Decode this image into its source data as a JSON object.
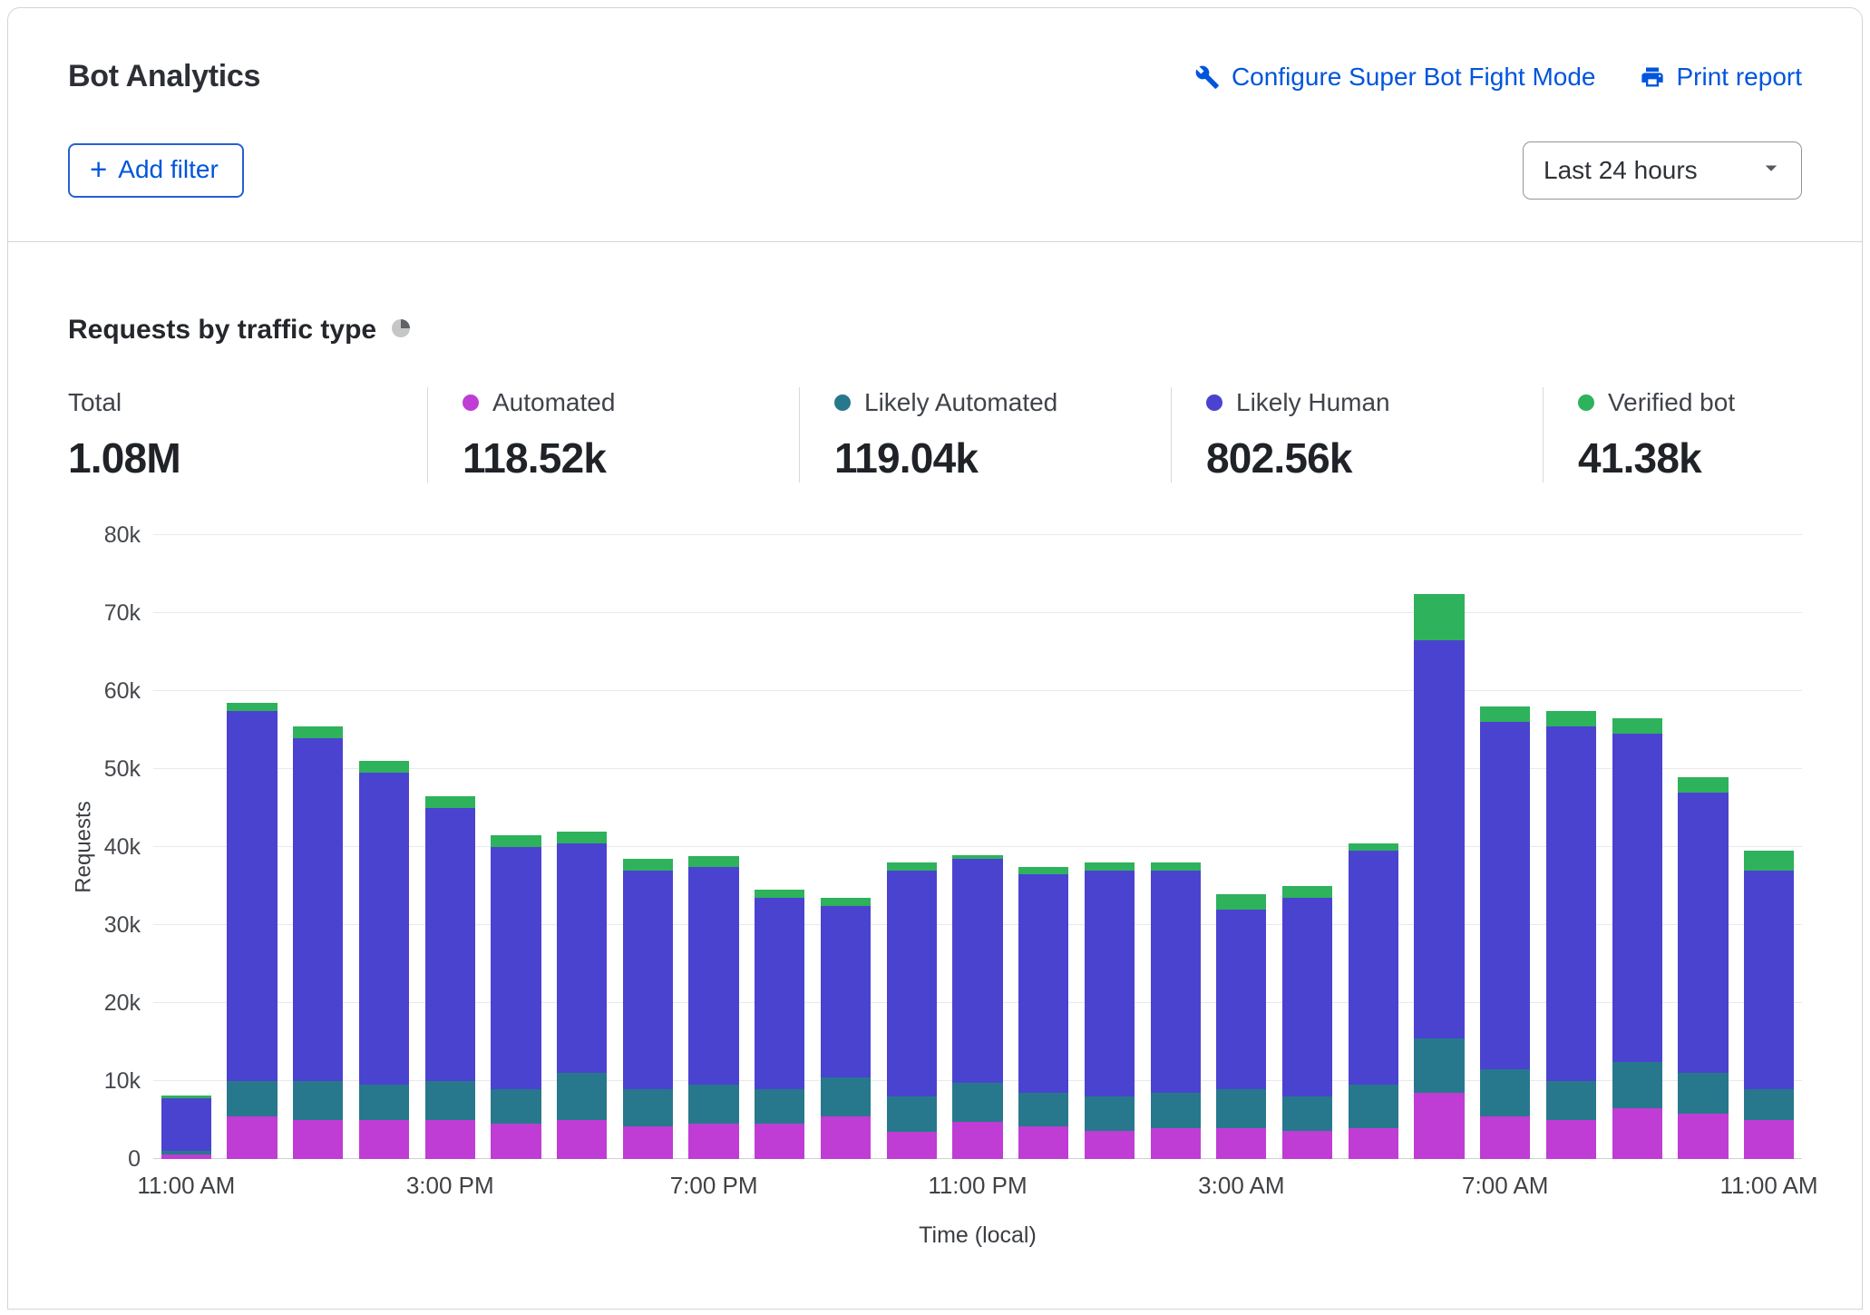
{
  "header": {
    "title": "Bot Analytics",
    "configure_link": "Configure Super Bot Fight Mode",
    "print_link": "Print report",
    "add_filter_label": "Add filter",
    "time_range": "Last 24 hours"
  },
  "section": {
    "title": "Requests by traffic type"
  },
  "colors": {
    "link_blue": "#0055dc",
    "automated": "#bf3dd4",
    "likely_automated": "#27788c",
    "likely_human": "#4a43d0",
    "verified_bot": "#2eb25b"
  },
  "stats": [
    {
      "label": "Total",
      "value": "1.08M",
      "color": null
    },
    {
      "label": "Automated",
      "value": "118.52k",
      "color": "#bf3dd4"
    },
    {
      "label": "Likely Automated",
      "value": "119.04k",
      "color": "#27788c"
    },
    {
      "label": "Likely Human",
      "value": "802.56k",
      "color": "#4a43d0"
    },
    {
      "label": "Verified bot",
      "value": "41.38k",
      "color": "#2eb25b"
    }
  ],
  "chart_data": {
    "type": "bar",
    "stacked": true,
    "title": "Requests by traffic type",
    "xlabel": "Time (local)",
    "ylabel": "Requests",
    "ylim": [
      0,
      80000
    ],
    "grid": true,
    "ytick_labels": [
      "0",
      "10k",
      "20k",
      "30k",
      "40k",
      "50k",
      "60k",
      "70k",
      "80k"
    ],
    "xtick_labels": [
      "11:00 AM",
      "3:00 PM",
      "7:00 PM",
      "11:00 PM",
      "3:00 AM",
      "7:00 AM",
      "11:00 AM"
    ],
    "xtick_bar_indices": [
      0,
      4,
      8,
      12,
      16,
      20,
      24
    ],
    "series": [
      {
        "name": "Automated",
        "color": "#bf3dd4",
        "values": [
          600,
          5500,
          5000,
          5000,
          5000,
          4500,
          5000,
          4200,
          4500,
          4500,
          5500,
          3500,
          4800,
          4200,
          3600,
          4000,
          4000,
          3600,
          4000,
          8500,
          5500,
          5000,
          6500,
          5800,
          5000
        ]
      },
      {
        "name": "Likely Automated",
        "color": "#27788c",
        "values": [
          400,
          4500,
          5000,
          4500,
          5000,
          4500,
          6000,
          4800,
          5000,
          4500,
          5000,
          4500,
          5000,
          4300,
          4400,
          4500,
          5000,
          4400,
          5500,
          7000,
          6000,
          5000,
          6000,
          5200,
          4000
        ]
      },
      {
        "name": "Likely Human",
        "color": "#4a43d0",
        "values": [
          6800,
          47500,
          44000,
          40000,
          35000,
          31000,
          29500,
          28000,
          28000,
          24500,
          22000,
          29000,
          28700,
          28000,
          29000,
          28500,
          23000,
          25500,
          30000,
          51000,
          44500,
          45500,
          42000,
          36000,
          28000
        ]
      },
      {
        "name": "Verified bot",
        "color": "#2eb25b",
        "values": [
          300,
          1000,
          1500,
          1500,
          1500,
          1500,
          1500,
          1500,
          1300,
          1000,
          1000,
          1000,
          500,
          1000,
          1000,
          1000,
          2000,
          1500,
          1000,
          6000,
          2000,
          2000,
          2000,
          2000,
          2500
        ]
      }
    ]
  }
}
